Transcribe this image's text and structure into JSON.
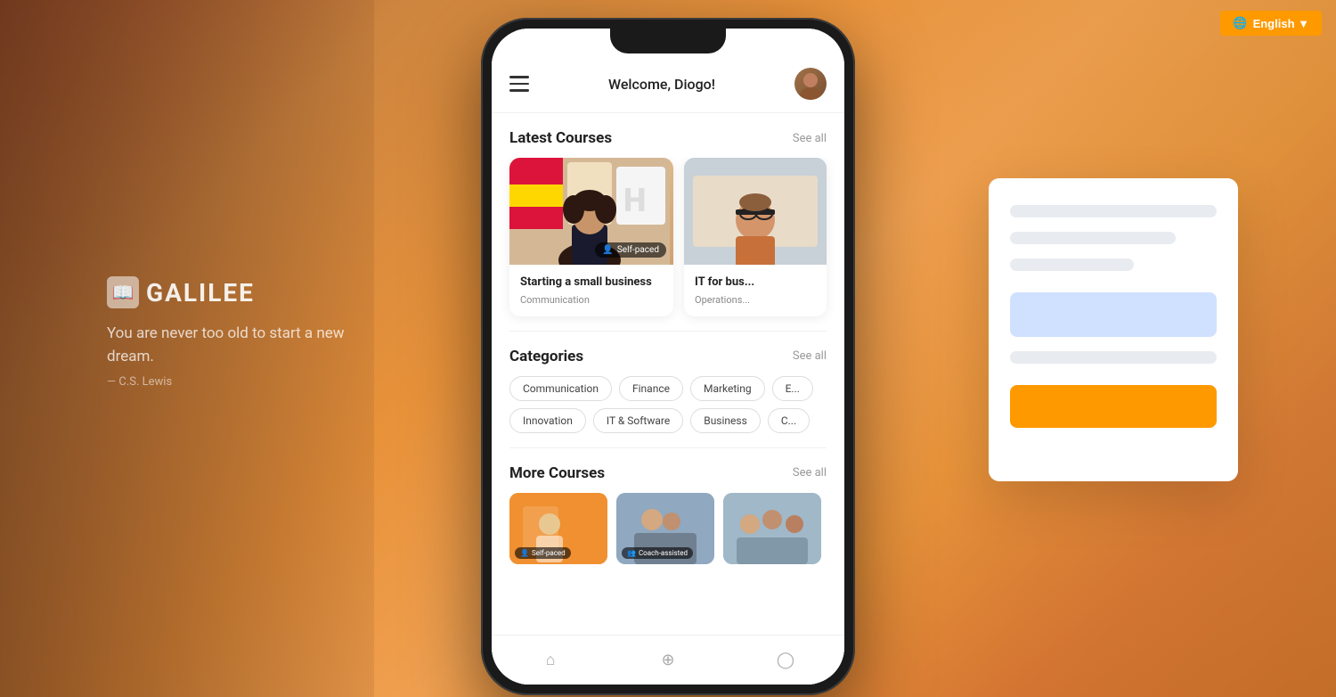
{
  "background": {
    "gradient_desc": "warm orange-brown gradient"
  },
  "top_button": {
    "label": "English ▼",
    "icon": "globe-icon"
  },
  "left_brand": {
    "logo_icon": "📖",
    "name": "GALILEE",
    "quote": "You are never too old to start a new dream.",
    "author": "— C.S. Lewis"
  },
  "app": {
    "header": {
      "welcome_text": "Welcome, Diogo!",
      "avatar_alt": "Diogo avatar"
    },
    "latest_courses": {
      "section_title": "Latest Courses",
      "see_all_label": "See all",
      "cards": [
        {
          "id": "course-1",
          "title": "Starting a small business",
          "category": "Communication",
          "badge": "Self-paced",
          "badge_icon": "person-icon"
        },
        {
          "id": "course-2",
          "title": "IT for bus...",
          "category": "Operations...",
          "badge": null
        }
      ]
    },
    "categories": {
      "section_title": "Categories",
      "see_all_label": "See all",
      "items": [
        {
          "label": "Communication"
        },
        {
          "label": "Finance"
        },
        {
          "label": "Marketing"
        },
        {
          "label": "E..."
        },
        {
          "label": "Innovation"
        },
        {
          "label": "IT & Software"
        },
        {
          "label": "Business"
        },
        {
          "label": "C..."
        }
      ]
    },
    "more_courses": {
      "section_title": "More Courses",
      "see_all_label": "See all",
      "cards": [
        {
          "id": "more-1",
          "badge": "Self-paced",
          "badge_icon": "person-icon"
        },
        {
          "id": "more-2",
          "badge": "Coach-assisted",
          "badge_icon": "group-icon"
        },
        {
          "id": "more-3",
          "badge": null
        }
      ]
    },
    "bottom_nav": {
      "items": [
        {
          "label": "home",
          "icon": "🏠"
        },
        {
          "label": "explore",
          "icon": "🔍"
        },
        {
          "label": "profile",
          "icon": "👤"
        }
      ]
    }
  }
}
